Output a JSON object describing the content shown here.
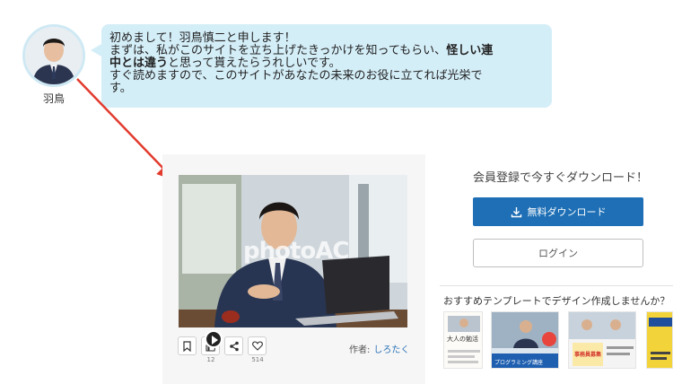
{
  "avatar": {
    "name": "羽鳥"
  },
  "bubble": {
    "line1": "初めまして！羽鳥慎二と申します！",
    "line2_part1": "まずは、私がこのサイトを立ち上げたきっかけを知ってもらい、",
    "line2_bold1": "怪しい連",
    "line3_bold2": "中とは違う",
    "line3_part2": "と思って貰えたらうれしいです。",
    "line4": "すぐ読めますので、このサイトがあなたの未来のお役に立てれば光栄で",
    "line5": "す。"
  },
  "photo": {
    "watermark": "photoAC"
  },
  "actions": {
    "bookmark_count": "",
    "like_count": "12",
    "share_count": "",
    "favorite_count": "514"
  },
  "author": {
    "label": "作者:",
    "name": "しろたく"
  },
  "register": {
    "title": "会員登録で今すぐダウンロード！",
    "download_label": "無料ダウンロード",
    "login_label": "ログイン"
  },
  "promo": {
    "title": "おすすめテンプレートでデザイン作成しませんか？",
    "thumb1_text": "大人の勉活",
    "thumb2_text": "プログラミング講座",
    "thumb3_text": "事務員募集"
  },
  "colors": {
    "bubble_bg": "#d4eef8",
    "primary_button": "#1e6fb5",
    "arrow": "#e23b2e",
    "author_link": "#2a72b5"
  }
}
